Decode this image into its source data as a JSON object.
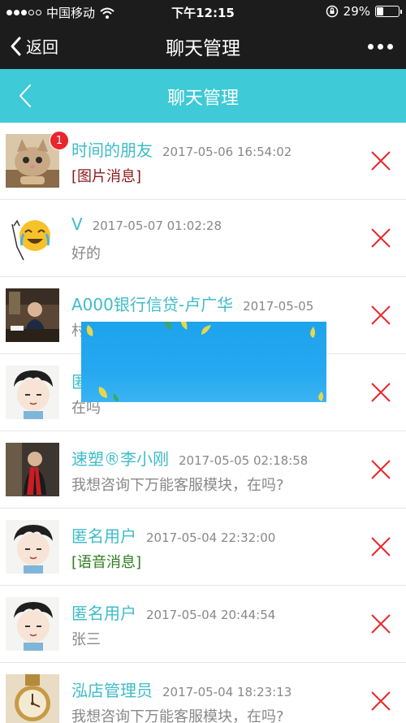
{
  "status_bar": {
    "carrier": "中国移动",
    "time": "下午12:15",
    "battery": "29%"
  },
  "wechat_header": {
    "back_label": "返回",
    "title": "聊天管理"
  },
  "page_header": {
    "title": "聊天管理"
  },
  "chats": [
    {
      "name": "时间的朋友",
      "time": "2017-05-06 16:54:02",
      "preview": "[图片消息]",
      "badge": "1",
      "avatar": "cat-avatar"
    },
    {
      "name": "V",
      "time": "2017-05-07 01:02:28",
      "preview": "好的",
      "avatar": "emoji-avatar"
    },
    {
      "name": "A000银行信贷-卢广华",
      "time": "2017-05-05",
      "preview": "村",
      "avatar": "office-avatar"
    },
    {
      "name": "匿",
      "time": "",
      "preview": "在吗",
      "avatar": "cartoon-boy-avatar"
    },
    {
      "name": "速塑®李小刚",
      "time": "2017-05-05 02:18:58",
      "preview": "我想咨询下万能客服模块，在吗?",
      "avatar": "red-scarf-avatar"
    },
    {
      "name": "匿名用户",
      "time": "2017-05-04 22:32:00",
      "preview": "[语音消息]",
      "avatar": "cartoon-boy-avatar"
    },
    {
      "name": "匿名用户",
      "time": "2017-05-04 20:44:54",
      "preview": "张三",
      "avatar": "cartoon-boy-avatar"
    },
    {
      "name": "泓店管理员",
      "time": "2017-05-04 18:23:13",
      "preview": "我想咨询下万能客服模块，在吗?",
      "avatar": "watch-avatar"
    }
  ],
  "colors": {
    "accent": "#3ecad6",
    "name": "#3ebcc8",
    "delete": "#e8262b",
    "dark_bar": "#1c1c1c"
  }
}
